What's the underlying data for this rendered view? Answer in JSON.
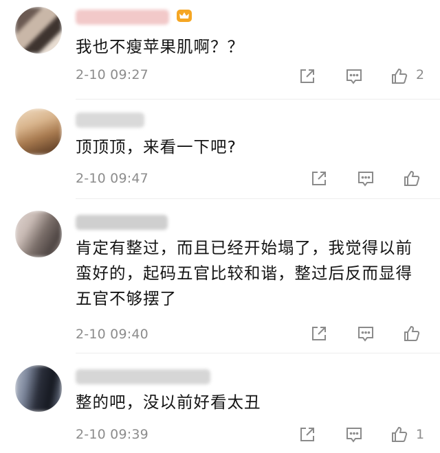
{
  "comments": [
    {
      "text": "我也不瘦苹果肌啊？？",
      "time": "2-10 09:27",
      "likes": "2",
      "vip_badge": true,
      "avatar_colors": [
        "#6b5a52",
        "#c9b7a8",
        "#3e342f",
        "#e8ddd2"
      ],
      "username_color": "#f2c9c9"
    },
    {
      "text": "顶顶顶，来看一下吧?",
      "time": "2-10 09:47",
      "likes": "",
      "vip_badge": false,
      "avatar_colors": [
        "#a87a4f",
        "#d8b48c",
        "#6d4a2e",
        "#f0dcc2"
      ],
      "username_color": "#d9d9d9"
    },
    {
      "text": "肯定有整过，而且已经开始塌了，我觉得以前蛮好的，起码五官比较和谐，整过后反而显得五官不够摆了",
      "time": "2-10 09:40",
      "likes": "",
      "vip_badge": false,
      "avatar_colors": [
        "#7b6f6a",
        "#c8bab4",
        "#4d4442",
        "#e2d7d3"
      ],
      "username_color": "#cfcfcf"
    },
    {
      "text": "整的吧，没以前好看太丑",
      "time": "2-10 09:39",
      "likes": "1",
      "vip_badge": false,
      "avatar_colors": [
        "#2a2e3a",
        "#7d879c",
        "#151820",
        "#b8bfcc"
      ],
      "username_color": "#d6d6d6"
    }
  ],
  "icons": {
    "share": "share-icon",
    "comment": "comment-icon",
    "like": "thumbs-up-icon",
    "badge": "crown-icon"
  },
  "colors": {
    "meta": "#8c8c8c",
    "text": "#141414",
    "badge": "#f5a623",
    "divider": "#ededed"
  }
}
